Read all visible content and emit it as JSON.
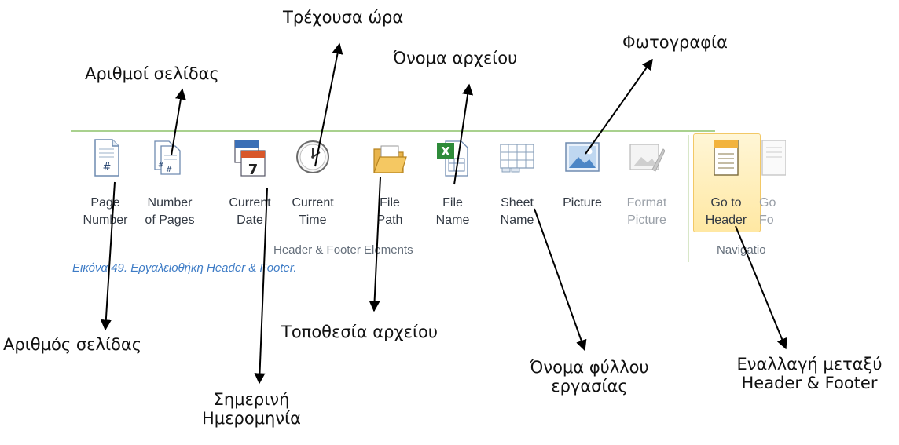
{
  "ribbon": {
    "buttons": [
      {
        "label": "Page\nNumber",
        "icon": "page-number-icon",
        "disabled": false
      },
      {
        "label": "Number\nof Pages",
        "icon": "number-of-pages-icon",
        "disabled": false
      },
      {
        "label": "Current\nDate",
        "icon": "current-date-icon",
        "disabled": false
      },
      {
        "label": "Current\nTime",
        "icon": "current-time-icon",
        "disabled": false
      },
      {
        "label": "File\nPath",
        "icon": "file-path-icon",
        "disabled": false
      },
      {
        "label": "File\nName",
        "icon": "file-name-icon",
        "disabled": false
      },
      {
        "label": "Sheet\nName",
        "icon": "sheet-name-icon",
        "disabled": false
      },
      {
        "label": "Picture",
        "icon": "picture-icon",
        "disabled": false
      },
      {
        "label": "Format\nPicture",
        "icon": "format-picture-icon",
        "disabled": true
      },
      {
        "label": "Go to\nHeader",
        "icon": "go-to-header-icon",
        "disabled": false,
        "active": true
      },
      {
        "label": "Go\nFo",
        "icon": "go-to-footer-icon",
        "disabled": true
      }
    ],
    "group_elements": "Header & Footer Elements",
    "group_navigation": "Navigatio",
    "calendar_day": "7"
  },
  "caption": "Εικόνα 49. Εργαλειοθήκη Header & Footer.",
  "annotations": {
    "current_time": "Τρέχουσα ώρα",
    "number_of_pages": "Αριθμοί σελίδας",
    "file_name": "Όνομα αρχείου",
    "picture": "Φωτογραφία",
    "page_number": "Αριθμός σελίδας",
    "file_path": "Τοποθεσία αρχείου",
    "current_date_line1": "Σημερινή",
    "current_date_line2": "Ημερομηνία",
    "sheet_name_line1": "Όνομα φύλλου",
    "sheet_name_line2": "εργασίας",
    "switch_line1": "Εναλλαγή μεταξύ",
    "switch_line2": "Header & Footer"
  },
  "colors": {
    "caption": "#3e7cc6",
    "ribbon_border": "#a9d18e",
    "highlight": "#ffe8a3"
  }
}
